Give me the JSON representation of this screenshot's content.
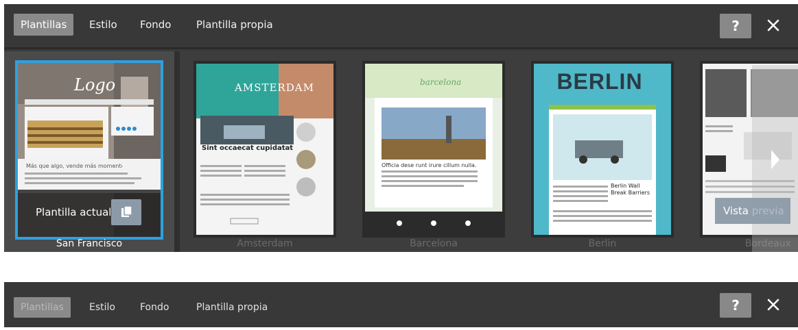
{
  "tabs": [
    {
      "label": "Plantillas",
      "active": true
    },
    {
      "label": "Estilo",
      "active": false
    },
    {
      "label": "Fondo",
      "active": false
    },
    {
      "label": "Plantilla propia",
      "active": false
    }
  ],
  "help_label": "?",
  "templates": [
    {
      "name": "San Francisco",
      "current": true,
      "logo_text": "Logo",
      "tagline": "Más que algo, vende más momento"
    },
    {
      "name": "Amsterdam",
      "current": false,
      "header_text": "AMSTERDAM",
      "headline": "Sint occaecat cupidatat"
    },
    {
      "name": "Barcelona",
      "current": false,
      "header_text": "barcelona",
      "headline": "Officia dese runt irure cillum nulla."
    },
    {
      "name": "Berlin",
      "current": false,
      "header_text": "BERLIN",
      "headline": "Berlin Wall Break Barriers"
    },
    {
      "name": "Bordeaux",
      "current": false
    }
  ],
  "current_label": "Plantilla actual",
  "preview_label": "Vista ",
  "preview_label_faded": "previa",
  "bottom_tabs": [
    {
      "label": "Plantillas",
      "active": true
    },
    {
      "label": "Estilo",
      "active": false
    },
    {
      "label": "Fondo",
      "active": false
    },
    {
      "label": "Plantilla propia",
      "active": false
    }
  ],
  "colors": {
    "accent": "#2ea1df",
    "bar": "#383838",
    "active_tab": "#8a8a8a"
  }
}
